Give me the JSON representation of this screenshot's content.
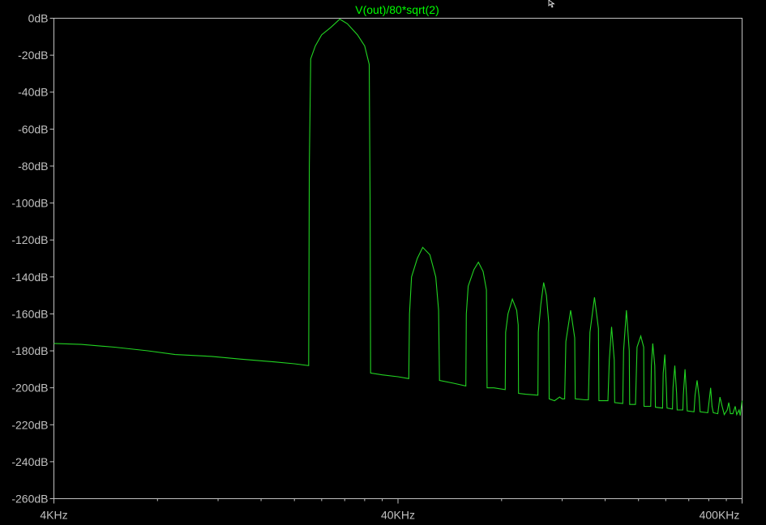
{
  "chart_data": {
    "type": "line",
    "title": "V(out)/80*sqrt(2)",
    "xscale": "log",
    "xlim": [
      4000,
      400000
    ],
    "ylim": [
      -260,
      0
    ],
    "x_tick_labels": [
      {
        "value": 4000,
        "label": "4KHz"
      },
      {
        "value": 40000,
        "label": "40KHz"
      },
      {
        "value": 400000,
        "label": "400KHz"
      }
    ],
    "y_tick_labels": [
      {
        "value": 0,
        "label": "0dB"
      },
      {
        "value": -20,
        "label": "-20dB"
      },
      {
        "value": -40,
        "label": "-40dB"
      },
      {
        "value": -60,
        "label": "-60dB"
      },
      {
        "value": -80,
        "label": "-80dB"
      },
      {
        "value": -100,
        "label": "-100dB"
      },
      {
        "value": -120,
        "label": "-120dB"
      },
      {
        "value": -140,
        "label": "-140dB"
      },
      {
        "value": -160,
        "label": "-160dB"
      },
      {
        "value": -180,
        "label": "-180dB"
      },
      {
        "value": -200,
        "label": "-200dB"
      },
      {
        "value": -220,
        "label": "-220dB"
      },
      {
        "value": -240,
        "label": "-240dB"
      },
      {
        "value": -260,
        "label": "-260dB"
      }
    ],
    "grid": false,
    "colors": {
      "trace": "#22d422",
      "title": "#00ff00",
      "axis": "#c0c0c0",
      "background": "#000000"
    },
    "series": [
      {
        "name": "V(out)/80*sqrt(2)",
        "points": [
          [
            4000,
            -176
          ],
          [
            4800,
            -176.5
          ],
          [
            6000,
            -178
          ],
          [
            7500,
            -180
          ],
          [
            9000,
            -182
          ],
          [
            11500,
            -183
          ],
          [
            14000,
            -184.5
          ],
          [
            17500,
            -186
          ],
          [
            20000,
            -187
          ],
          [
            22000,
            -188
          ],
          [
            22100,
            -80
          ],
          [
            22300,
            -22
          ],
          [
            23000,
            -15
          ],
          [
            24000,
            -9
          ],
          [
            25500,
            -5
          ],
          [
            27100,
            -0.5
          ],
          [
            28500,
            -3
          ],
          [
            30500,
            -9
          ],
          [
            32000,
            -15
          ],
          [
            33000,
            -25
          ],
          [
            33200,
            -100
          ],
          [
            33300,
            -192
          ],
          [
            36000,
            -193
          ],
          [
            40000,
            -194
          ],
          [
            43000,
            -195
          ],
          [
            43200,
            -160
          ],
          [
            43800,
            -140
          ],
          [
            45500,
            -130
          ],
          [
            47200,
            -124
          ],
          [
            49500,
            -128
          ],
          [
            51500,
            -140
          ],
          [
            52500,
            -158
          ],
          [
            52800,
            -196
          ],
          [
            58000,
            -197.5
          ],
          [
            63000,
            -199
          ],
          [
            63200,
            -160
          ],
          [
            64000,
            -145
          ],
          [
            66500,
            -136
          ],
          [
            68500,
            -132
          ],
          [
            70700,
            -137
          ],
          [
            72300,
            -147
          ],
          [
            72600,
            -200
          ],
          [
            76000,
            -200
          ],
          [
            82000,
            -201
          ],
          [
            82200,
            -170
          ],
          [
            83500,
            -160
          ],
          [
            86000,
            -152
          ],
          [
            88500,
            -158
          ],
          [
            89400,
            -166
          ],
          [
            89600,
            -203
          ],
          [
            94000,
            -203.5
          ],
          [
            102000,
            -204
          ],
          [
            102300,
            -170
          ],
          [
            104000,
            -155
          ],
          [
            106000,
            -143
          ],
          [
            108000,
            -150
          ],
          [
            109700,
            -165
          ],
          [
            110000,
            -206
          ],
          [
            114000,
            -207
          ],
          [
            118000,
            -205
          ],
          [
            120000,
            -206
          ],
          [
            122000,
            -206
          ],
          [
            123000,
            -175
          ],
          [
            127000,
            -158
          ],
          [
            130500,
            -173
          ],
          [
            131000,
            -206
          ],
          [
            140000,
            -206.5
          ],
          [
            143000,
            -206.5
          ],
          [
            144500,
            -170
          ],
          [
            149000,
            -151
          ],
          [
            153000,
            -168
          ],
          [
            153500,
            -207
          ],
          [
            163000,
            -207
          ],
          [
            164500,
            -185
          ],
          [
            167000,
            -167
          ],
          [
            170000,
            -185
          ],
          [
            170500,
            -208
          ],
          [
            180000,
            -208.5
          ],
          [
            181000,
            -180
          ],
          [
            184500,
            -158
          ],
          [
            188000,
            -180
          ],
          [
            188500,
            -209
          ],
          [
            196000,
            -209
          ],
          [
            198000,
            -178
          ],
          [
            203000,
            -172
          ],
          [
            207000,
            -178
          ],
          [
            207500,
            -210
          ],
          [
            217000,
            -210
          ],
          [
            218000,
            -188
          ],
          [
            220000,
            -176
          ],
          [
            223000,
            -188
          ],
          [
            224000,
            -210.5
          ],
          [
            235000,
            -211
          ],
          [
            236000,
            -192
          ],
          [
            238500,
            -182
          ],
          [
            241000,
            -200
          ],
          [
            242000,
            -211
          ],
          [
            251000,
            -211.5
          ],
          [
            252000,
            -200
          ],
          [
            255000,
            -188
          ],
          [
            258000,
            -203
          ],
          [
            259000,
            -212
          ],
          [
            269000,
            -212
          ],
          [
            270000,
            -204
          ],
          [
            273000,
            -190
          ],
          [
            276000,
            -205
          ],
          [
            277000,
            -212.5
          ],
          [
            290000,
            -213
          ],
          [
            292000,
            -204
          ],
          [
            296000,
            -196
          ],
          [
            300000,
            -205
          ],
          [
            302000,
            -213
          ],
          [
            318000,
            -213.5
          ],
          [
            321000,
            -207
          ],
          [
            324000,
            -200
          ],
          [
            327000,
            -210
          ],
          [
            330000,
            -213.5
          ],
          [
            340000,
            -214
          ],
          [
            345000,
            -205
          ],
          [
            350000,
            -210
          ],
          [
            355000,
            -214.5
          ],
          [
            362000,
            -212
          ],
          [
            366000,
            -208
          ],
          [
            370000,
            -214
          ],
          [
            376000,
            -214
          ],
          [
            382000,
            -210
          ],
          [
            386000,
            -214.5
          ],
          [
            392000,
            -212
          ],
          [
            395000,
            -215
          ],
          [
            398000,
            -210
          ],
          [
            400000,
            -207
          ]
        ]
      }
    ]
  },
  "cursor_icon": "mouse-pointer-icon"
}
